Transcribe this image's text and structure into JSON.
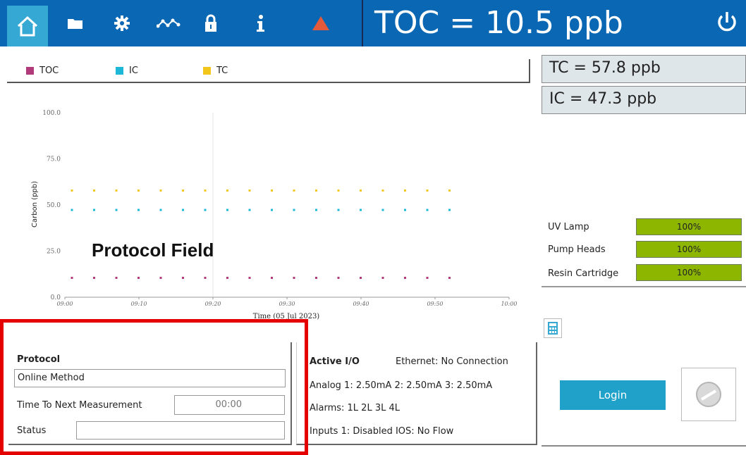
{
  "toolbar": {
    "icons": [
      "home-icon",
      "folder-icon",
      "gear-icon",
      "network-icon",
      "lock-icon",
      "info-icon",
      "alarm-icon",
      "power-icon"
    ],
    "title": "TOC = 10.5 ppb",
    "accent": "#0a67b3",
    "home_bg": "#35a9d4"
  },
  "readouts": {
    "tc": "TC = 57.8 ppb",
    "ic": "IC = 47.3 ppb"
  },
  "annotation": "Protocol Field",
  "chart_data": {
    "type": "scatter",
    "xlabel": "Time (05 Jul 2023)",
    "ylabel": "Carbon (ppb)",
    "ylim": [
      0,
      100
    ],
    "xticks": [
      "09:00",
      "09:10",
      "09:20",
      "09:30",
      "09:40",
      "09:50",
      "10:00"
    ],
    "yticks": [
      "0.0",
      "25.0",
      "50.0",
      "75.0",
      "100.0"
    ],
    "x_minutes_from_0900": [
      0,
      3,
      6,
      9,
      12,
      15,
      18,
      21,
      24,
      27,
      30,
      33,
      36,
      39,
      42,
      45,
      48,
      51
    ],
    "series": [
      {
        "name": "TOC",
        "color": "#b03a7a",
        "values": [
          10.5,
          10.5,
          10.5,
          10.5,
          10.5,
          10.5,
          10.5,
          10.5,
          10.5,
          10.5,
          10.5,
          10.5,
          10.5,
          10.5,
          10.5,
          10.5,
          10.5,
          10.5
        ]
      },
      {
        "name": "IC",
        "color": "#1db8d8",
        "values": [
          47.3,
          47.3,
          47.3,
          47.3,
          47.3,
          47.3,
          47.3,
          47.3,
          47.3,
          47.3,
          47.3,
          47.3,
          47.3,
          47.3,
          47.3,
          47.3,
          47.3,
          47.3
        ]
      },
      {
        "name": "TC",
        "color": "#f3c61c",
        "values": [
          57.8,
          57.8,
          57.8,
          57.8,
          57.8,
          57.8,
          57.8,
          57.8,
          57.8,
          57.8,
          57.8,
          57.8,
          57.8,
          57.8,
          57.8,
          57.8,
          57.8,
          57.8
        ]
      }
    ],
    "legend": "top",
    "grid": false
  },
  "consumables": [
    {
      "label": "UV Lamp",
      "value": "100%",
      "fraction": 1.0
    },
    {
      "label": "Pump Heads",
      "value": "100%",
      "fraction": 1.0
    },
    {
      "label": "Resin Cartridge",
      "value": "100%",
      "fraction": 1.0
    }
  ],
  "protocol": {
    "title": "Protocol",
    "method": "Online Method",
    "ttn_label": "Time To Next Measurement",
    "ttn_value": "00:00",
    "status_label": "Status",
    "status_value": ""
  },
  "io": {
    "title": "Active I/O",
    "ethernet": "Ethernet: No Connection",
    "analog": "Analog 1: 2.50mA  2: 2.50mA  3: 2.50mA",
    "alarms": "Alarms: 1L 2L 3L 4L",
    "inputs": "Inputs 1: Disabled  IOS: No Flow"
  },
  "login": {
    "label": "Login",
    "color": "#1fa1c9"
  },
  "consumable_color": "#8db600"
}
